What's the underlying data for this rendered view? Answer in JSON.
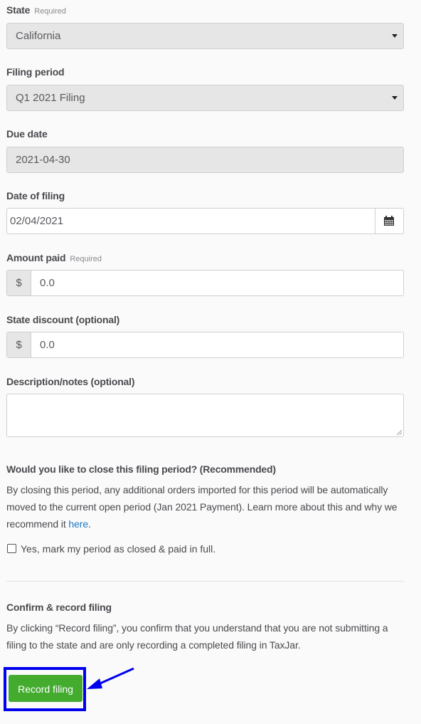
{
  "form": {
    "state": {
      "label": "State",
      "required_tag": "Required",
      "value": "California"
    },
    "filing_period": {
      "label": "Filing period",
      "value": "Q1 2021 Filing"
    },
    "due_date": {
      "label": "Due date",
      "value": "2021-04-30"
    },
    "date_of_filing": {
      "label": "Date of filing",
      "value": "02/04/2021",
      "icon": "calendar-icon"
    },
    "amount_paid": {
      "label": "Amount paid",
      "required_tag": "Required",
      "prefix": "$",
      "value": "0.0"
    },
    "state_discount": {
      "label": "State discount (optional)",
      "prefix": "$",
      "value": "0.0"
    },
    "notes": {
      "label": "Description/notes (optional)",
      "value": ""
    }
  },
  "close_period": {
    "heading": "Would you like to close this filing period? (Recommended)",
    "text_before_link": "By closing this period, any additional orders imported for this period will be automatically moved to the current open period (Jan 2021 Payment). Learn more about this and why we recommend it ",
    "link_text": "here",
    "text_after_link": ".",
    "checkbox_label": "Yes, mark my period as closed & paid in full.",
    "checked": false
  },
  "confirm": {
    "heading": "Confirm & record filing",
    "text": "By clicking “Record filing”, you confirm that you understand that you are not submitting a filing to the state and are only recording a completed filing in TaxJar.",
    "button_label": "Record filing"
  },
  "colors": {
    "accent_button": "#43ac2f",
    "link": "#1f78c1",
    "annotation": "#0000ee"
  }
}
